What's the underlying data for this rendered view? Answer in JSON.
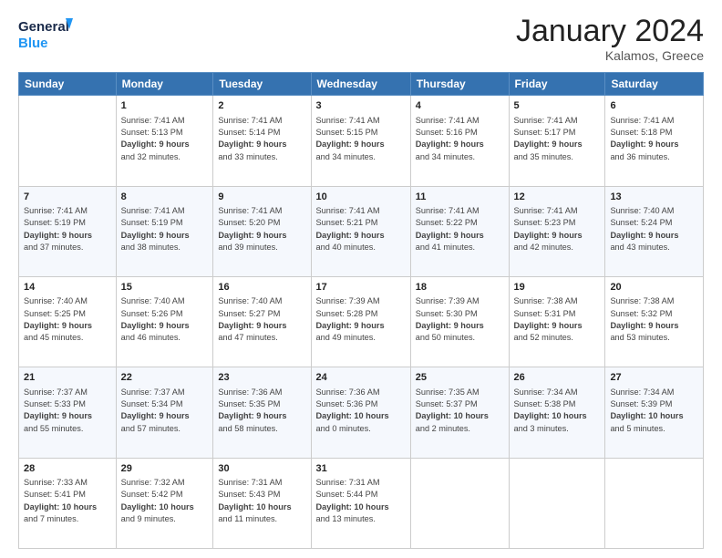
{
  "header": {
    "logo_line1": "General",
    "logo_line2": "Blue",
    "month": "January 2024",
    "location": "Kalamos, Greece"
  },
  "weekdays": [
    "Sunday",
    "Monday",
    "Tuesday",
    "Wednesday",
    "Thursday",
    "Friday",
    "Saturday"
  ],
  "weeks": [
    [
      {
        "day": "",
        "info": ""
      },
      {
        "day": "1",
        "info": "Sunrise: 7:41 AM\nSunset: 5:13 PM\nDaylight: 9 hours\nand 32 minutes."
      },
      {
        "day": "2",
        "info": "Sunrise: 7:41 AM\nSunset: 5:14 PM\nDaylight: 9 hours\nand 33 minutes."
      },
      {
        "day": "3",
        "info": "Sunrise: 7:41 AM\nSunset: 5:15 PM\nDaylight: 9 hours\nand 34 minutes."
      },
      {
        "day": "4",
        "info": "Sunrise: 7:41 AM\nSunset: 5:16 PM\nDaylight: 9 hours\nand 34 minutes."
      },
      {
        "day": "5",
        "info": "Sunrise: 7:41 AM\nSunset: 5:17 PM\nDaylight: 9 hours\nand 35 minutes."
      },
      {
        "day": "6",
        "info": "Sunrise: 7:41 AM\nSunset: 5:18 PM\nDaylight: 9 hours\nand 36 minutes."
      }
    ],
    [
      {
        "day": "7",
        "info": "Sunrise: 7:41 AM\nSunset: 5:19 PM\nDaylight: 9 hours\nand 37 minutes."
      },
      {
        "day": "8",
        "info": "Sunrise: 7:41 AM\nSunset: 5:19 PM\nDaylight: 9 hours\nand 38 minutes."
      },
      {
        "day": "9",
        "info": "Sunrise: 7:41 AM\nSunset: 5:20 PM\nDaylight: 9 hours\nand 39 minutes."
      },
      {
        "day": "10",
        "info": "Sunrise: 7:41 AM\nSunset: 5:21 PM\nDaylight: 9 hours\nand 40 minutes."
      },
      {
        "day": "11",
        "info": "Sunrise: 7:41 AM\nSunset: 5:22 PM\nDaylight: 9 hours\nand 41 minutes."
      },
      {
        "day": "12",
        "info": "Sunrise: 7:41 AM\nSunset: 5:23 PM\nDaylight: 9 hours\nand 42 minutes."
      },
      {
        "day": "13",
        "info": "Sunrise: 7:40 AM\nSunset: 5:24 PM\nDaylight: 9 hours\nand 43 minutes."
      }
    ],
    [
      {
        "day": "14",
        "info": "Sunrise: 7:40 AM\nSunset: 5:25 PM\nDaylight: 9 hours\nand 45 minutes."
      },
      {
        "day": "15",
        "info": "Sunrise: 7:40 AM\nSunset: 5:26 PM\nDaylight: 9 hours\nand 46 minutes."
      },
      {
        "day": "16",
        "info": "Sunrise: 7:40 AM\nSunset: 5:27 PM\nDaylight: 9 hours\nand 47 minutes."
      },
      {
        "day": "17",
        "info": "Sunrise: 7:39 AM\nSunset: 5:28 PM\nDaylight: 9 hours\nand 49 minutes."
      },
      {
        "day": "18",
        "info": "Sunrise: 7:39 AM\nSunset: 5:30 PM\nDaylight: 9 hours\nand 50 minutes."
      },
      {
        "day": "19",
        "info": "Sunrise: 7:38 AM\nSunset: 5:31 PM\nDaylight: 9 hours\nand 52 minutes."
      },
      {
        "day": "20",
        "info": "Sunrise: 7:38 AM\nSunset: 5:32 PM\nDaylight: 9 hours\nand 53 minutes."
      }
    ],
    [
      {
        "day": "21",
        "info": "Sunrise: 7:37 AM\nSunset: 5:33 PM\nDaylight: 9 hours\nand 55 minutes."
      },
      {
        "day": "22",
        "info": "Sunrise: 7:37 AM\nSunset: 5:34 PM\nDaylight: 9 hours\nand 57 minutes."
      },
      {
        "day": "23",
        "info": "Sunrise: 7:36 AM\nSunset: 5:35 PM\nDaylight: 9 hours\nand 58 minutes."
      },
      {
        "day": "24",
        "info": "Sunrise: 7:36 AM\nSunset: 5:36 PM\nDaylight: 10 hours\nand 0 minutes."
      },
      {
        "day": "25",
        "info": "Sunrise: 7:35 AM\nSunset: 5:37 PM\nDaylight: 10 hours\nand 2 minutes."
      },
      {
        "day": "26",
        "info": "Sunrise: 7:34 AM\nSunset: 5:38 PM\nDaylight: 10 hours\nand 3 minutes."
      },
      {
        "day": "27",
        "info": "Sunrise: 7:34 AM\nSunset: 5:39 PM\nDaylight: 10 hours\nand 5 minutes."
      }
    ],
    [
      {
        "day": "28",
        "info": "Sunrise: 7:33 AM\nSunset: 5:41 PM\nDaylight: 10 hours\nand 7 minutes."
      },
      {
        "day": "29",
        "info": "Sunrise: 7:32 AM\nSunset: 5:42 PM\nDaylight: 10 hours\nand 9 minutes."
      },
      {
        "day": "30",
        "info": "Sunrise: 7:31 AM\nSunset: 5:43 PM\nDaylight: 10 hours\nand 11 minutes."
      },
      {
        "day": "31",
        "info": "Sunrise: 7:31 AM\nSunset: 5:44 PM\nDaylight: 10 hours\nand 13 minutes."
      },
      {
        "day": "",
        "info": ""
      },
      {
        "day": "",
        "info": ""
      },
      {
        "day": "",
        "info": ""
      }
    ]
  ]
}
